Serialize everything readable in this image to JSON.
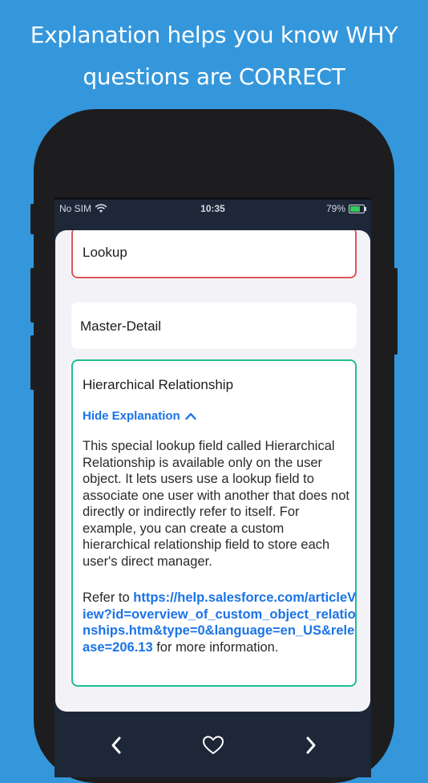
{
  "headline": {
    "line1": "Explanation helps you know WHY",
    "line2": "questions are CORRECT"
  },
  "status": {
    "carrier": "No SIM",
    "time": "10:35",
    "battery": "79%"
  },
  "options": [
    {
      "label": "Lookup",
      "state": "incorrect"
    },
    {
      "label": "Master-Detail",
      "state": "neutral"
    },
    {
      "label": "Hierarchical Relationship",
      "state": "correct"
    }
  ],
  "explanation": {
    "toggle_label": "Hide Explanation",
    "body": "This special lookup field called Hierarchical Relationship is available only on the user object. It lets users use a lookup field to associate one user with another that does not directly or indirectly refer to itself. For example, you can create a custom hierarchical relationship field to store each user's direct manager.",
    "refer_prefix": "Refer to ",
    "refer_link": "https://help.salesforce.com/articleView?id=overview_of_custom_object_relationships.htm&type=0&language=en_US&release=206.13",
    "refer_suffix": " for more information."
  },
  "nav": {
    "prev_icon": "chevron-left-icon",
    "fav_icon": "heart-icon",
    "next_icon": "chevron-right-icon"
  },
  "colors": {
    "background": "#3597db",
    "incorrect": "#e0545a",
    "correct": "#1fbf91",
    "link": "#1a73e8"
  }
}
